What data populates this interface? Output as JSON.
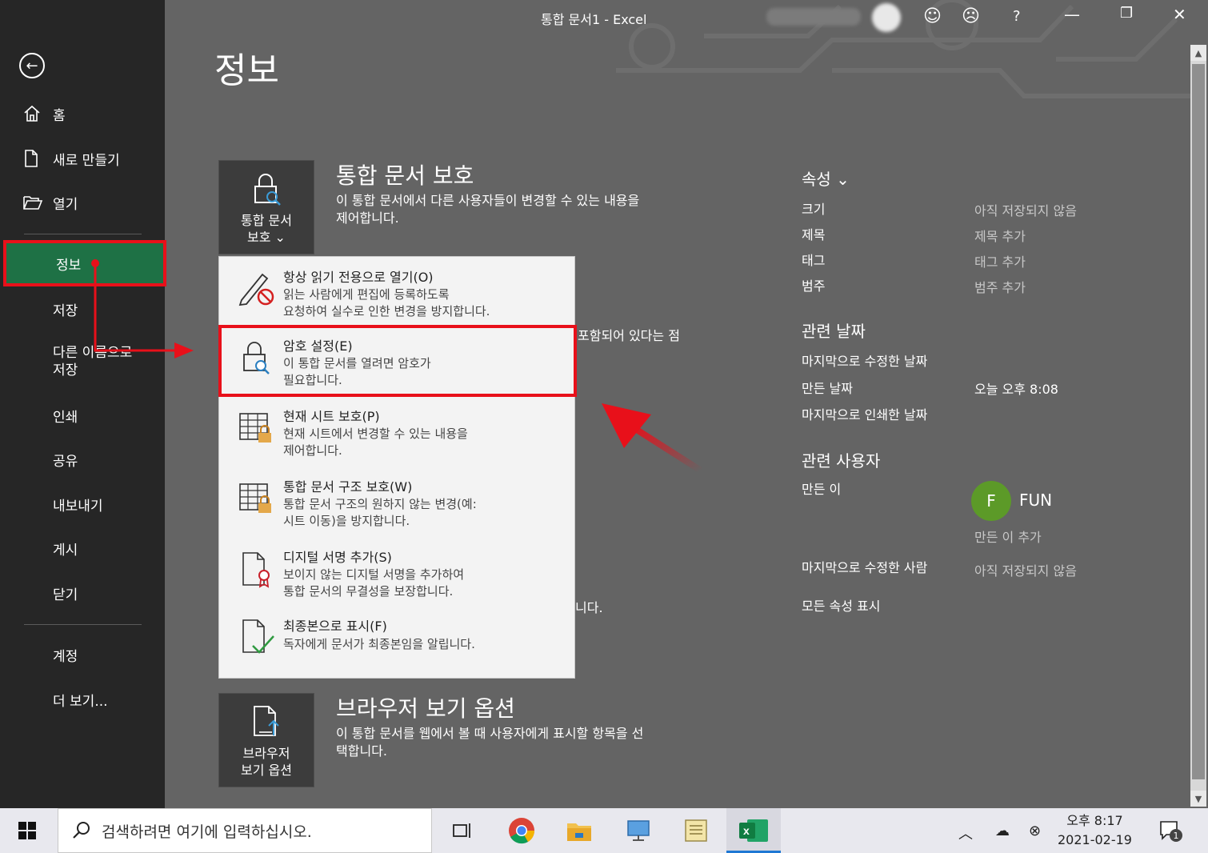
{
  "window": {
    "title": "통합 문서1  -  Excel",
    "help": "?"
  },
  "sidebar": {
    "items": [
      {
        "label": "홈"
      },
      {
        "label": "새로 만들기"
      },
      {
        "label": "열기"
      },
      {
        "label": "정보"
      },
      {
        "label": "저장"
      },
      {
        "label": "다른 이름으로\n저장"
      },
      {
        "label": "인쇄"
      },
      {
        "label": "공유"
      },
      {
        "label": "내보내기"
      },
      {
        "label": "게시"
      },
      {
        "label": "닫기"
      },
      {
        "label": "계정"
      },
      {
        "label": "더 보기..."
      }
    ]
  },
  "page": {
    "title": "정보"
  },
  "protect": {
    "tile_label": "통합 문서\n보호 ⌄",
    "title": "통합 문서 보호",
    "desc": "이 통합 문서에서 다른 사용자들이 변경할 수 있는 내용을\n제어합니다."
  },
  "menu": {
    "items": [
      {
        "title": "항상 읽기 전용으로 열기(O)",
        "desc": "읽는 사람에게 편집에 등록하도록\n요청하여 실수로 인한 변경을 방지합니다."
      },
      {
        "title": "암호 설정(E)",
        "desc": "이 통합 문서를 열려면 암호가\n필요합니다."
      },
      {
        "title": "현재 시트 보호(P)",
        "desc": "현재 시트에서 변경할 수 있는 내용을\n제어합니다."
      },
      {
        "title": "통합 문서 구조 보호(W)",
        "desc": "통합 문서 구조의 원하지 않는 변경(예:\n시트 이동)을 방지합니다."
      },
      {
        "title": "디지털 서명 추가(S)",
        "desc": "보이지 않는 디지털 서명을 추가하여\n통합 문서의 무결성을 보장합니다."
      },
      {
        "title": "최종본으로 표시(F)",
        "desc": "독자에게 문서가 최종본임을 알립니다."
      }
    ]
  },
  "partial_text": {
    "a": "포함되어 있다는 점",
    "b": "니다."
  },
  "browser": {
    "tile_label": "브라우저\n보기 옵션",
    "title": "브라우저 보기 옵션",
    "desc": "이 통합 문서를 웹에서 볼 때 사용자에게 표시할 항목을 선\n택합니다."
  },
  "properties": {
    "heading": "속성 ⌄",
    "rows": [
      {
        "label": "크기",
        "value": "아직 저장되지 않음"
      },
      {
        "label": "제목",
        "value": "제목 추가"
      },
      {
        "label": "태그",
        "value": "태그 추가"
      },
      {
        "label": "범주",
        "value": "범주 추가"
      }
    ],
    "dates_heading": "관련 날짜",
    "dates": [
      {
        "label": "마지막으로 수정한 날짜",
        "value": ""
      },
      {
        "label": "만든 날짜",
        "value": "오늘 오후 8:08"
      },
      {
        "label": "마지막으로 인쇄한 날짜",
        "value": ""
      }
    ],
    "people_heading": "관련 사용자",
    "author_label": "만든 이",
    "author_initial": "F",
    "author_name": "FUN",
    "add_author": "만든 이 추가",
    "last_modified_by_label": "마지막으로 수정한 사람",
    "last_modified_by_value": "아직 저장되지 않음",
    "show_all": "모든 속성 표시"
  },
  "taskbar": {
    "search_placeholder": "검색하려면 여기에 입력하십시오.",
    "time": "오후 8:17",
    "date": "2021-02-19",
    "notification_count": "1"
  },
  "colors": {
    "accent": "#1e7145",
    "highlight": "#e8101a",
    "avatar": "#5c9a28"
  }
}
